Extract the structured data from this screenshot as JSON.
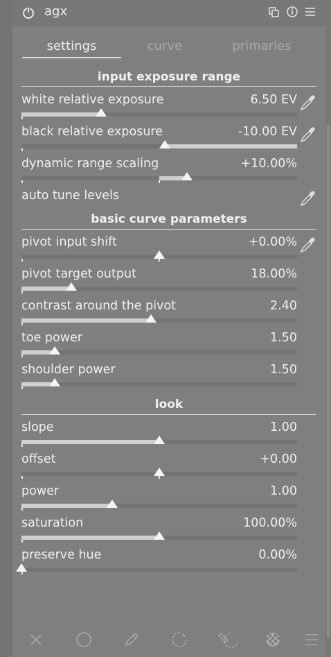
{
  "module": {
    "title": "agx",
    "header_icons": [
      "presets-icon",
      "reset-icon",
      "menu-icon"
    ]
  },
  "tabs": [
    {
      "label": "settings",
      "active": true
    },
    {
      "label": "curve",
      "active": false
    },
    {
      "label": "primaries",
      "active": false
    }
  ],
  "sections": {
    "input_exposure_range": "input exposure range",
    "basic_curve_parameters": "basic curve parameters",
    "look": "look"
  },
  "sliders": {
    "white_relative_exposure": {
      "label": "white relative exposure",
      "value": "6.50 EV",
      "fraction": 0.29,
      "picker": true
    },
    "black_relative_exposure": {
      "label": "black relative exposure",
      "value": "-10.00 EV",
      "fraction": 0.52,
      "picker": true,
      "fill_from_thumb": true
    },
    "dynamic_range_scaling": {
      "label": "dynamic range scaling",
      "value": "+10.00%",
      "fraction": 0.6,
      "centered": true
    },
    "auto_tune_levels": {
      "label": "auto tune levels",
      "picker": true
    },
    "pivot_input_shift": {
      "label": "pivot input shift",
      "value": "+0.00%",
      "fraction": 0.5,
      "centered": true,
      "picker": true
    },
    "pivot_target_output": {
      "label": "pivot target output",
      "value": "18.00%",
      "fraction": 0.18
    },
    "contrast_around_pivot": {
      "label": "contrast around the pivot",
      "value": "2.40",
      "fraction": 0.47
    },
    "toe_power": {
      "label": "toe power",
      "value": "1.50",
      "fraction": 0.12
    },
    "shoulder_power": {
      "label": "shoulder power",
      "value": "1.50",
      "fraction": 0.12
    },
    "slope": {
      "label": "slope",
      "value": "1.00",
      "fraction": 0.5
    },
    "offset": {
      "label": "offset",
      "value": "+0.00",
      "fraction": 0.5,
      "centered": true
    },
    "power": {
      "label": "power",
      "value": "1.00",
      "fraction": 0.33
    },
    "saturation": {
      "label": "saturation",
      "value": "100.00%",
      "fraction": 0.5
    },
    "preserve_hue": {
      "label": "preserve hue",
      "value": "0.00%",
      "fraction": 0.0
    }
  },
  "bottom_bar_icons": [
    "close-icon",
    "circle-icon",
    "pencil-icon",
    "drawn-parametric-icon",
    "parametric-icon",
    "raster-mask-icon",
    "menu-icon"
  ]
}
